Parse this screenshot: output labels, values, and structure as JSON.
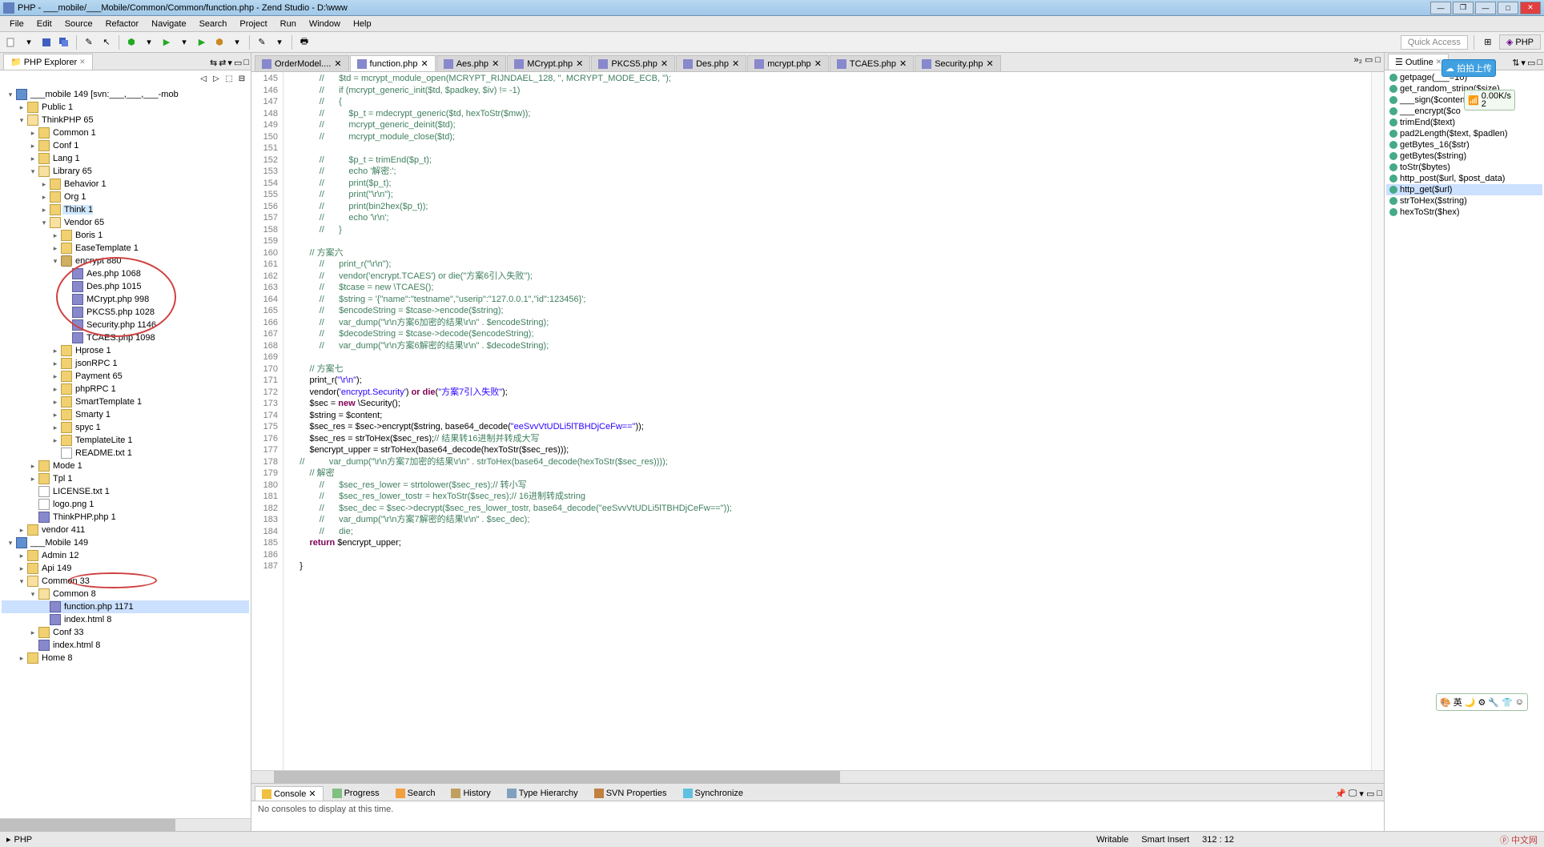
{
  "title": "PHP - ___mobile/___Mobile/Common/Common/function.php - Zend Studio - D:\\www",
  "menus": [
    "File",
    "Edit",
    "Source",
    "Refactor",
    "Navigate",
    "Search",
    "Project",
    "Run",
    "Window",
    "Help"
  ],
  "quick_access": "Quick Access",
  "perspective": "PHP",
  "explorer": {
    "title": "PHP Explorer",
    "nodes": [
      {
        "d": 0,
        "exp": true,
        "icon": "proj",
        "label": "___mobile 149 [svn:___,___,___-mob"
      },
      {
        "d": 1,
        "exp": false,
        "icon": "folder",
        "label": "Public 1"
      },
      {
        "d": 1,
        "exp": true,
        "icon": "folder-open",
        "label": "ThinkPHP 65"
      },
      {
        "d": 2,
        "exp": false,
        "icon": "folder",
        "label": "Common 1"
      },
      {
        "d": 2,
        "exp": false,
        "icon": "folder",
        "label": "Conf 1"
      },
      {
        "d": 2,
        "exp": false,
        "icon": "folder",
        "label": "Lang 1"
      },
      {
        "d": 2,
        "exp": true,
        "icon": "folder-open",
        "label": "Library 65"
      },
      {
        "d": 3,
        "exp": false,
        "icon": "folder",
        "label": "Behavior 1"
      },
      {
        "d": 3,
        "exp": false,
        "icon": "folder",
        "label": "Org 1"
      },
      {
        "d": 3,
        "exp": false,
        "icon": "folder",
        "label": "Think 1",
        "hl": true
      },
      {
        "d": 3,
        "exp": true,
        "icon": "folder-open",
        "label": "Vendor 65"
      },
      {
        "d": 4,
        "exp": false,
        "icon": "folder",
        "label": "Boris 1"
      },
      {
        "d": 4,
        "exp": false,
        "icon": "folder",
        "label": "EaseTemplate 1"
      },
      {
        "d": 4,
        "exp": true,
        "icon": "pkg",
        "label": "encrypt 880"
      },
      {
        "d": 5,
        "icon": "php",
        "label": "Aes.php 1068"
      },
      {
        "d": 5,
        "icon": "php",
        "label": "Des.php 1015"
      },
      {
        "d": 5,
        "icon": "php",
        "label": "MCrypt.php 998"
      },
      {
        "d": 5,
        "icon": "php",
        "label": "PKCS5.php 1028"
      },
      {
        "d": 5,
        "icon": "php",
        "label": "Security.php 1146"
      },
      {
        "d": 5,
        "icon": "php",
        "label": "TCAES.php 1098"
      },
      {
        "d": 4,
        "exp": false,
        "icon": "folder",
        "label": "Hprose 1"
      },
      {
        "d": 4,
        "exp": false,
        "icon": "folder",
        "label": "jsonRPC 1"
      },
      {
        "d": 4,
        "exp": false,
        "icon": "folder",
        "label": "Payment 65"
      },
      {
        "d": 4,
        "exp": false,
        "icon": "folder",
        "label": "phpRPC 1"
      },
      {
        "d": 4,
        "exp": false,
        "icon": "folder",
        "label": "SmartTemplate 1"
      },
      {
        "d": 4,
        "exp": false,
        "icon": "folder",
        "label": "Smarty 1"
      },
      {
        "d": 4,
        "exp": false,
        "icon": "folder",
        "label": "spyc 1"
      },
      {
        "d": 4,
        "exp": false,
        "icon": "folder",
        "label": "TemplateLite 1"
      },
      {
        "d": 4,
        "icon": "file",
        "label": "README.txt 1"
      },
      {
        "d": 2,
        "exp": false,
        "icon": "folder",
        "label": "Mode 1"
      },
      {
        "d": 2,
        "exp": false,
        "icon": "folder",
        "label": "Tpl 1"
      },
      {
        "d": 2,
        "icon": "file",
        "label": "LICENSE.txt 1"
      },
      {
        "d": 2,
        "icon": "file",
        "label": "logo.png 1"
      },
      {
        "d": 2,
        "icon": "php",
        "label": "ThinkPHP.php 1"
      },
      {
        "d": 1,
        "exp": false,
        "icon": "folder",
        "label": "vendor 411"
      },
      {
        "d": 0,
        "exp": true,
        "icon": "proj",
        "label": "___Mobile 149"
      },
      {
        "d": 1,
        "exp": false,
        "icon": "folder",
        "label": "Admin 12"
      },
      {
        "d": 1,
        "exp": false,
        "icon": "folder",
        "label": "Api 149"
      },
      {
        "d": 1,
        "exp": true,
        "icon": "folder-open",
        "label": "Common 33"
      },
      {
        "d": 2,
        "exp": true,
        "icon": "folder-open",
        "label": "Common 8"
      },
      {
        "d": 3,
        "icon": "php",
        "label": "function.php 1171",
        "sel": true
      },
      {
        "d": 3,
        "icon": "php",
        "label": "index.html 8"
      },
      {
        "d": 2,
        "exp": false,
        "icon": "folder",
        "label": "Conf 33"
      },
      {
        "d": 2,
        "icon": "php",
        "label": "index.html 8"
      },
      {
        "d": 1,
        "exp": false,
        "icon": "folder",
        "label": "Home 8"
      }
    ]
  },
  "editor": {
    "tabs": [
      "OrderModel....",
      "function.php",
      "Aes.php",
      "MCrypt.php",
      "PKCS5.php",
      "Des.php",
      "mcrypt.php",
      "TCAES.php",
      "Security.php"
    ],
    "active_tab": 1,
    "overflow": "»₂",
    "first_line": 145,
    "lines": [
      {
        "raw": "//",
        "cls": "c-cmt",
        "indent": 3,
        "tail": "$td = mcrypt_module_open(MCRYPT_RIJNDAEL_128, '', MCRYPT_MODE_ECB, '');"
      },
      {
        "raw": "//",
        "cls": "c-cmt",
        "indent": 3,
        "tail": "if (mcrypt_generic_init($td, $padkey, $iv) != -1)"
      },
      {
        "raw": "//",
        "cls": "c-cmt",
        "indent": 3,
        "tail": "{"
      },
      {
        "raw": "//",
        "cls": "c-cmt",
        "indent": 3,
        "tail": "    $p_t = mdecrypt_generic($td, hexToStr($mw));"
      },
      {
        "raw": "//",
        "cls": "c-cmt",
        "indent": 3,
        "tail": "    mcrypt_generic_deinit($td);"
      },
      {
        "raw": "//",
        "cls": "c-cmt",
        "indent": 3,
        "tail": "    mcrypt_module_close($td);"
      },
      {
        "raw": "",
        "cls": "",
        "indent": 3,
        "tail": ""
      },
      {
        "raw": "//",
        "cls": "c-cmt",
        "indent": 3,
        "tail": "    $p_t = trimEnd($p_t);"
      },
      {
        "raw": "//",
        "cls": "c-cmt",
        "indent": 3,
        "tail": "    echo '解密:';"
      },
      {
        "raw": "//",
        "cls": "c-cmt",
        "indent": 3,
        "tail": "    print($p_t);"
      },
      {
        "raw": "//",
        "cls": "c-cmt",
        "indent": 3,
        "tail": "    print(\"\\r\\n\");"
      },
      {
        "raw": "//",
        "cls": "c-cmt",
        "indent": 3,
        "tail": "    print(bin2hex($p_t));"
      },
      {
        "raw": "//",
        "cls": "c-cmt",
        "indent": 3,
        "tail": "    echo '\\r\\n';"
      },
      {
        "raw": "//",
        "cls": "c-cmt",
        "indent": 3,
        "tail": "}"
      },
      {
        "raw": "",
        "cls": "",
        "indent": 3,
        "tail": ""
      },
      {
        "raw": "// 方案六",
        "cls": "c-cmt",
        "indent": 2,
        "tail": ""
      },
      {
        "raw": "//",
        "cls": "c-cmt",
        "indent": 3,
        "tail": "print_r(\"\\r\\n\");"
      },
      {
        "raw": "//",
        "cls": "c-cmt",
        "indent": 3,
        "tail": "vendor('encrypt.TCAES') or die(\"方案6引入失败\");"
      },
      {
        "raw": "//",
        "cls": "c-cmt",
        "indent": 3,
        "tail": "$tcase = new \\TCAES();"
      },
      {
        "raw": "//",
        "cls": "c-cmt",
        "indent": 3,
        "tail": "$string = '{\"name\":\"testname\",\"userip\":\"127.0.0.1\",\"id\":123456}';"
      },
      {
        "raw": "//",
        "cls": "c-cmt",
        "indent": 3,
        "tail": "$encodeString = $tcase->encode($string);"
      },
      {
        "raw": "//",
        "cls": "c-cmt",
        "indent": 3,
        "tail": "var_dump(\"\\r\\n方案6加密的结果\\r\\n\" . $encodeString);"
      },
      {
        "raw": "//",
        "cls": "c-cmt",
        "indent": 3,
        "tail": "$decodeString = $tcase->decode($encodeString);"
      },
      {
        "raw": "//",
        "cls": "c-cmt",
        "indent": 3,
        "tail": "var_dump(\"\\r\\n方案6解密的结果\\r\\n\" . $decodeString);"
      },
      {
        "raw": "",
        "cls": "",
        "indent": 3,
        "tail": ""
      },
      {
        "raw": "// 方案七",
        "cls": "c-cmt",
        "indent": 2,
        "tail": ""
      },
      {
        "code": "print_r(<span class='c-str'>\"\\r\\n\"</span>);",
        "indent": 2
      },
      {
        "code": "vendor(<span class='c-str'>'encrypt.Security'</span>) <span class='c-kw'>or</span> <span class='c-kw'>die</span>(<span class='c-str'>\"方案7引入失败\"</span>);",
        "indent": 2
      },
      {
        "code": "$sec = <span class='c-kw'>new</span> \\Security();",
        "indent": 2
      },
      {
        "code": "$string = $content;",
        "indent": 2
      },
      {
        "code": "$sec_res = $sec->encrypt($string, base64_decode(<span class='c-str'>\"eeSvvVtUDLi5lTBHDjCeFw==\"</span>));",
        "indent": 2
      },
      {
        "code": "$sec_res = strToHex($sec_res);<span class='c-cmt'>// 结果转16进制并转成大写</span>",
        "indent": 2
      },
      {
        "code": "$encrypt_upper = strToHex(base64_decode(hexToStr($sec_res)));",
        "indent": 2
      },
      {
        "raw": "//",
        "cls": "c-cmt",
        "indent": 1,
        "tail": "    var_dump(\"\\r\\n方案7加密的结果\\r\\n\" . strToHex(base64_decode(hexToStr($sec_res))));"
      },
      {
        "raw": "// 解密",
        "cls": "c-cmt",
        "indent": 2,
        "tail": ""
      },
      {
        "raw": "//",
        "cls": "c-cmt",
        "indent": 3,
        "tail": "$sec_res_lower = strtolower($sec_res);// 转小写"
      },
      {
        "raw": "//",
        "cls": "c-cmt",
        "indent": 3,
        "tail": "$sec_res_lower_tostr = hexToStr($sec_res);// 16进制转成string"
      },
      {
        "raw": "//",
        "cls": "c-cmt",
        "indent": 3,
        "tail": "$sec_dec = $sec->decrypt($sec_res_lower_tostr, base64_decode(\"eeSvvVtUDLi5lTBHDjCeFw==\"));"
      },
      {
        "raw": "//",
        "cls": "c-cmt",
        "indent": 3,
        "tail": "var_dump(\"\\r\\n方案7解密的结果\\r\\n\" . $sec_dec);"
      },
      {
        "raw": "//",
        "cls": "c-cmt",
        "indent": 3,
        "tail": "die;"
      },
      {
        "code": "<span class='c-kw'>return</span> $encrypt_upper;",
        "indent": 2
      },
      {
        "raw": "",
        "cls": "",
        "indent": 2,
        "tail": ""
      },
      {
        "raw": "}",
        "cls": "",
        "indent": 1,
        "tail": ""
      }
    ]
  },
  "outline": {
    "title": "Outline",
    "items": [
      "getpage(___=10)",
      "get_random_string($size)",
      "___sign($conten",
      "___encrypt($co",
      "trimEnd($text)",
      "pad2Length($text, $padlen)",
      "getBytes_16($str)",
      "getBytes($string)",
      "toStr($bytes)",
      "http_post($url, $post_data)",
      "http_get($url)",
      "strToHex($string)",
      "hexToStr($hex)"
    ],
    "selected": 10
  },
  "bottom_tabs": [
    "Console",
    "Progress",
    "Search",
    "History",
    "Type Hierarchy",
    "SVN Properties",
    "Synchronize"
  ],
  "console_msg": "No consoles to display at this time.",
  "status": {
    "left_icon": "▸",
    "perspective": "PHP",
    "writable": "Writable",
    "insert": "Smart Insert",
    "pos": "312 : 12"
  },
  "float1": {
    "label": "拍拍上传"
  },
  "float2": {
    "speed": "0.00K/s",
    "count": "2"
  },
  "ime": {
    "label": "英"
  }
}
